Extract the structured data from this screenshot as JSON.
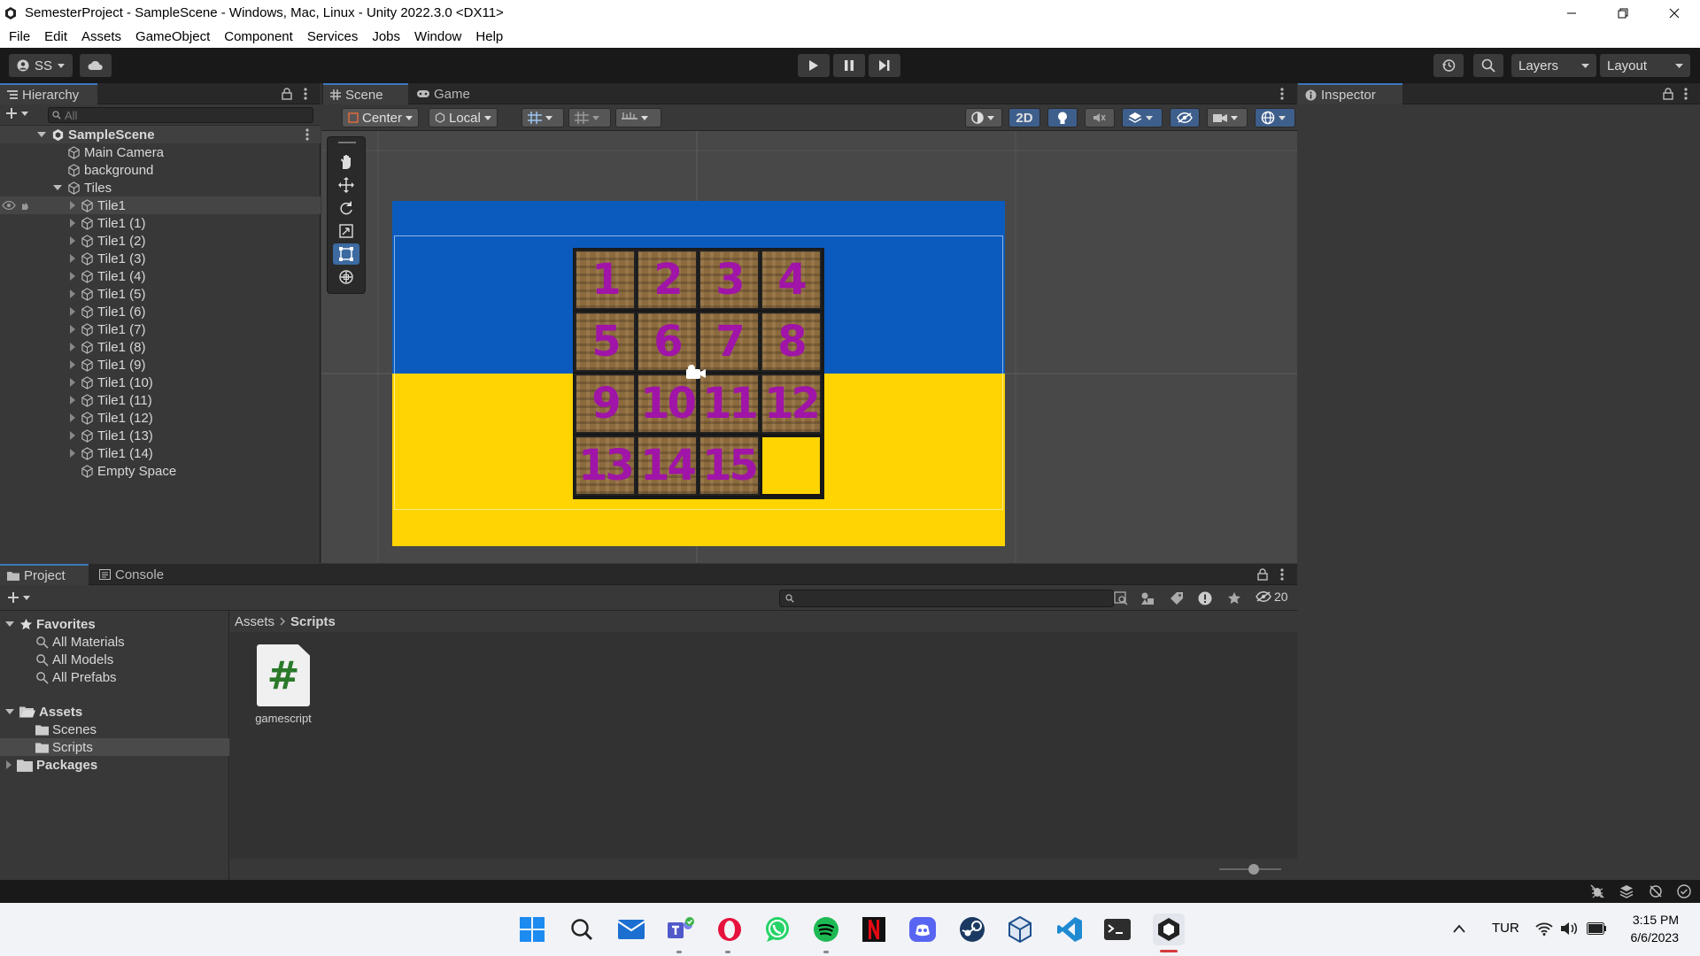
{
  "window": {
    "title": "SemesterProject - SampleScene - Windows, Mac, Linux - Unity 2022.3.0 <DX11>",
    "controls": [
      "minimize-icon",
      "restore-icon",
      "close-icon"
    ]
  },
  "menu": {
    "items": [
      "File",
      "Edit",
      "Assets",
      "GameObject",
      "Component",
      "Services",
      "Jobs",
      "Window",
      "Help"
    ]
  },
  "toolbar": {
    "account_label": "SS",
    "layers_label": "Layers",
    "layout_label": "Layout"
  },
  "hierarchy": {
    "tab_label": "Hierarchy",
    "search_placeholder": "All",
    "scene_name": "SampleScene",
    "items": [
      {
        "label": "Main Camera"
      },
      {
        "label": "background"
      },
      {
        "label": "Tiles"
      },
      {
        "label": "Tile1"
      },
      {
        "label": "Tile1 (1)"
      },
      {
        "label": "Tile1 (2)"
      },
      {
        "label": "Tile1 (3)"
      },
      {
        "label": "Tile1 (4)"
      },
      {
        "label": "Tile1 (5)"
      },
      {
        "label": "Tile1 (6)"
      },
      {
        "label": "Tile1 (7)"
      },
      {
        "label": "Tile1 (8)"
      },
      {
        "label": "Tile1 (9)"
      },
      {
        "label": "Tile1 (10)"
      },
      {
        "label": "Tile1 (11)"
      },
      {
        "label": "Tile1 (12)"
      },
      {
        "label": "Tile1 (13)"
      },
      {
        "label": "Tile1 (14)"
      },
      {
        "label": "Empty Space"
      }
    ]
  },
  "scene": {
    "tabs": [
      "Scene",
      "Game"
    ],
    "pivot_label": "Center",
    "space_label": "Local",
    "mode_2d_label": "2D",
    "tiles": [
      "1",
      "2",
      "3",
      "4",
      "5",
      "6",
      "7",
      "8",
      "9",
      "10",
      "11",
      "12",
      "13",
      "14",
      "15"
    ],
    "colors": {
      "flag_blue": "#0a5bbd",
      "flag_yellow": "#ffd400",
      "digit_purple": "#a014a8"
    }
  },
  "inspector": {
    "tab_label": "Inspector"
  },
  "project": {
    "tabs": [
      "Project",
      "Console"
    ],
    "visibility_count": "20",
    "favorites_label": "Favorites",
    "favorites": [
      "All Materials",
      "All Models",
      "All Prefabs"
    ],
    "assets_label": "Assets",
    "asset_folders": [
      "Scenes",
      "Scripts"
    ],
    "packages_label": "Packages",
    "breadcrumb": [
      "Assets",
      "Scripts"
    ],
    "files": [
      {
        "name": "gamescript",
        "glyph": "#"
      }
    ]
  },
  "taskbar": {
    "language": "TUR",
    "time": "3:15 PM",
    "date": "6/6/2023"
  }
}
